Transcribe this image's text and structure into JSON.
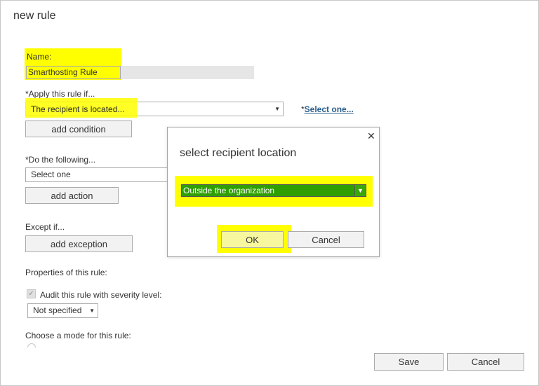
{
  "page": {
    "title": "new rule"
  },
  "form": {
    "name_label": "Name:",
    "name_value": "Smarthosting Rule",
    "apply_label": "*Apply this rule if...",
    "apply_selected": "The recipient is located...",
    "select_one_star": "*",
    "select_one_link": "Select one...",
    "add_condition": "add condition",
    "do_label": "*Do the following...",
    "do_selected": "Select one",
    "add_action": "add action",
    "except_label": "Except if...",
    "add_exception": "add exception",
    "properties_label": "Properties of this rule:",
    "audit_label": "Audit this rule with severity level:",
    "severity_selected": "Not specified",
    "mode_label": "Choose a mode for this rule:"
  },
  "footer": {
    "save": "Save",
    "cancel": "Cancel"
  },
  "dialog": {
    "title": "select recipient location",
    "location_selected": "Outside the organization",
    "ok": "OK",
    "cancel": "Cancel"
  },
  "icons": {
    "close": "close-icon",
    "dropdown": "chevron-down-icon",
    "check": "checkmark-icon"
  },
  "colors": {
    "highlight": "#ffff00",
    "selected_option_bg": "#2e9e00",
    "link": "#2a5e8c"
  }
}
